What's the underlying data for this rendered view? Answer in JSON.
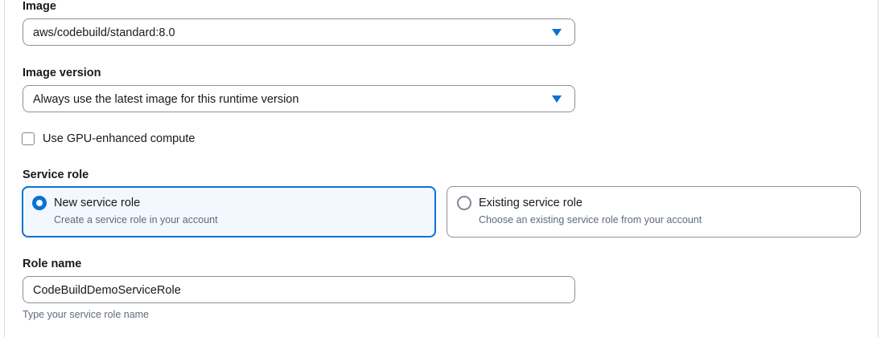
{
  "image": {
    "label": "Image",
    "selected_value": "aws/codebuild/standard:8.0"
  },
  "image_version": {
    "label": "Image version",
    "selected_value": "Always use the latest image for this runtime version"
  },
  "gpu": {
    "label": "Use GPU-enhanced compute",
    "checked": false
  },
  "service_role": {
    "label": "Service role",
    "options": [
      {
        "title": "New service role",
        "description": "Create a service role in your account",
        "selected": true
      },
      {
        "title": "Existing service role",
        "description": "Choose an existing service role from your account",
        "selected": false
      }
    ]
  },
  "role_name": {
    "label": "Role name",
    "value": "CodeBuildDemoServiceRole",
    "hint": "Type your service role name"
  },
  "colors": {
    "accent": "#0972d3",
    "border": "#8d9296",
    "text": "#16191f",
    "secondary_text": "#5f6b7a",
    "selected_tile_bg": "#f2f8fd"
  },
  "icons": {
    "dropdown": "caret-down-icon",
    "radio_selected": "radio-selected-icon",
    "radio_unselected": "radio-unselected-icon",
    "checkbox": "checkbox-unchecked-icon"
  }
}
